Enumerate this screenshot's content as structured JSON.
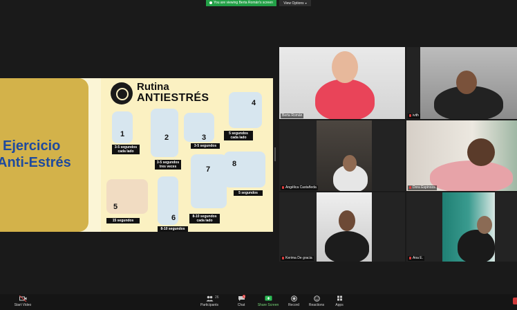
{
  "banner": {
    "text": "You are viewing Berta Román's screen",
    "color": "#23a047"
  },
  "view_options": {
    "label": "View Options",
    "icon": "chevron-down-icon"
  },
  "slide": {
    "title_line1": "Ejercicio",
    "title_line2": "Anti-Estrés",
    "poster_title_line1": "Rutina",
    "poster_title_line2": "ANTIESTRÉS",
    "steps": [
      {
        "number": "1",
        "label": "3-5 segundos cada lado"
      },
      {
        "number": "2",
        "label": "3-5 segundos tres veces"
      },
      {
        "number": "3",
        "label": "3-5 segundos"
      },
      {
        "number": "4",
        "label": "5 segundos cada lado"
      },
      {
        "number": "5",
        "label": "15 segundos"
      },
      {
        "number": "6",
        "label": "8-10 segundos"
      },
      {
        "number": "7",
        "label": "8-10 segundos cada lado"
      },
      {
        "number": "8",
        "label": "5 segundos"
      }
    ]
  },
  "participants": [
    {
      "name": "Berta Román"
    },
    {
      "name": "ivith"
    },
    {
      "name": "Angélica Castañeda"
    },
    {
      "name": "Dora Espinoza"
    },
    {
      "name": "Kerima De gracia"
    },
    {
      "name": "Ana E."
    }
  ],
  "toolbar": {
    "start_video": "Start Video",
    "participants": "Participants",
    "participants_count": "26",
    "chat": "Chat",
    "chat_badge": "1",
    "share_screen": "Share Screen",
    "record": "Record",
    "reactions": "Reactions",
    "apps": "Apps"
  },
  "colors": {
    "active_speaker": "#c6e56a",
    "slide_gold": "#d3b24a",
    "slide_title": "#1e4a9e"
  }
}
